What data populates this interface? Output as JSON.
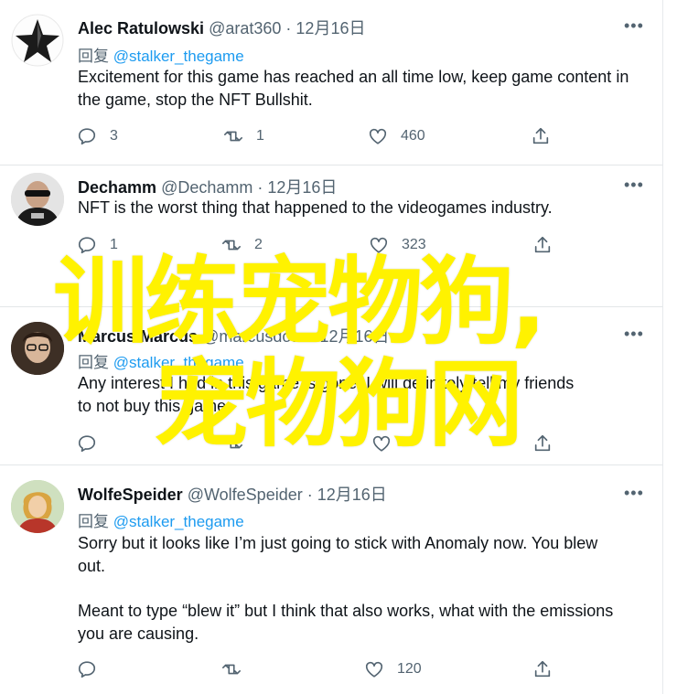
{
  "tweets": [
    {
      "name": "Alec Ratulowski",
      "handle": "@arat360",
      "date": "12月16日",
      "reply_prefix": "回复",
      "reply_to": "@stalker_thegame",
      "lines": [
        "Excitement for this game has reached an all time low, keep game content in",
        "the game, stop the NFT Bullshit."
      ],
      "replies": "3",
      "retweets": "1",
      "likes": "460"
    },
    {
      "name": "Dechamm",
      "handle": "@Dechamm",
      "date": "12月16日",
      "lines": [
        "NFT is the worst thing that happened to the videogames industry."
      ],
      "replies": "1",
      "retweets": "2",
      "likes": "323"
    },
    {
      "name": "Marcus Marcus",
      "handle": "@marcusdoto",
      "date": "12月16日",
      "reply_prefix": "回复",
      "reply_to": "@stalker_thegame",
      "lines": [
        "Any interest I had in this game is gone. I will definitely tell my friends",
        "to not buy this game."
      ],
      "replies": "",
      "retweets": "",
      "likes": ""
    },
    {
      "name": "WolfeSpeider",
      "handle": "@WolfeSpeider",
      "date": "12月16日",
      "reply_prefix": "回复",
      "reply_to": "@stalker_thegame",
      "lines": [
        "Sorry but it looks like I’m just going to stick with Anomaly now. You blew",
        "out.",
        "",
        "Meant to type “blew it” but I think that also works, what with the emissions",
        "you are causing."
      ],
      "replies": "",
      "retweets": "",
      "likes": "120"
    }
  ],
  "separator": "·",
  "overlay": {
    "line1": "训练宠物狗,",
    "line2": "宠物狗网",
    "color": "#fff200"
  },
  "icons": {
    "reply": "reply-icon",
    "retweet": "retweet-icon",
    "like": "like-icon",
    "share": "share-icon",
    "more": "more-icon"
  }
}
